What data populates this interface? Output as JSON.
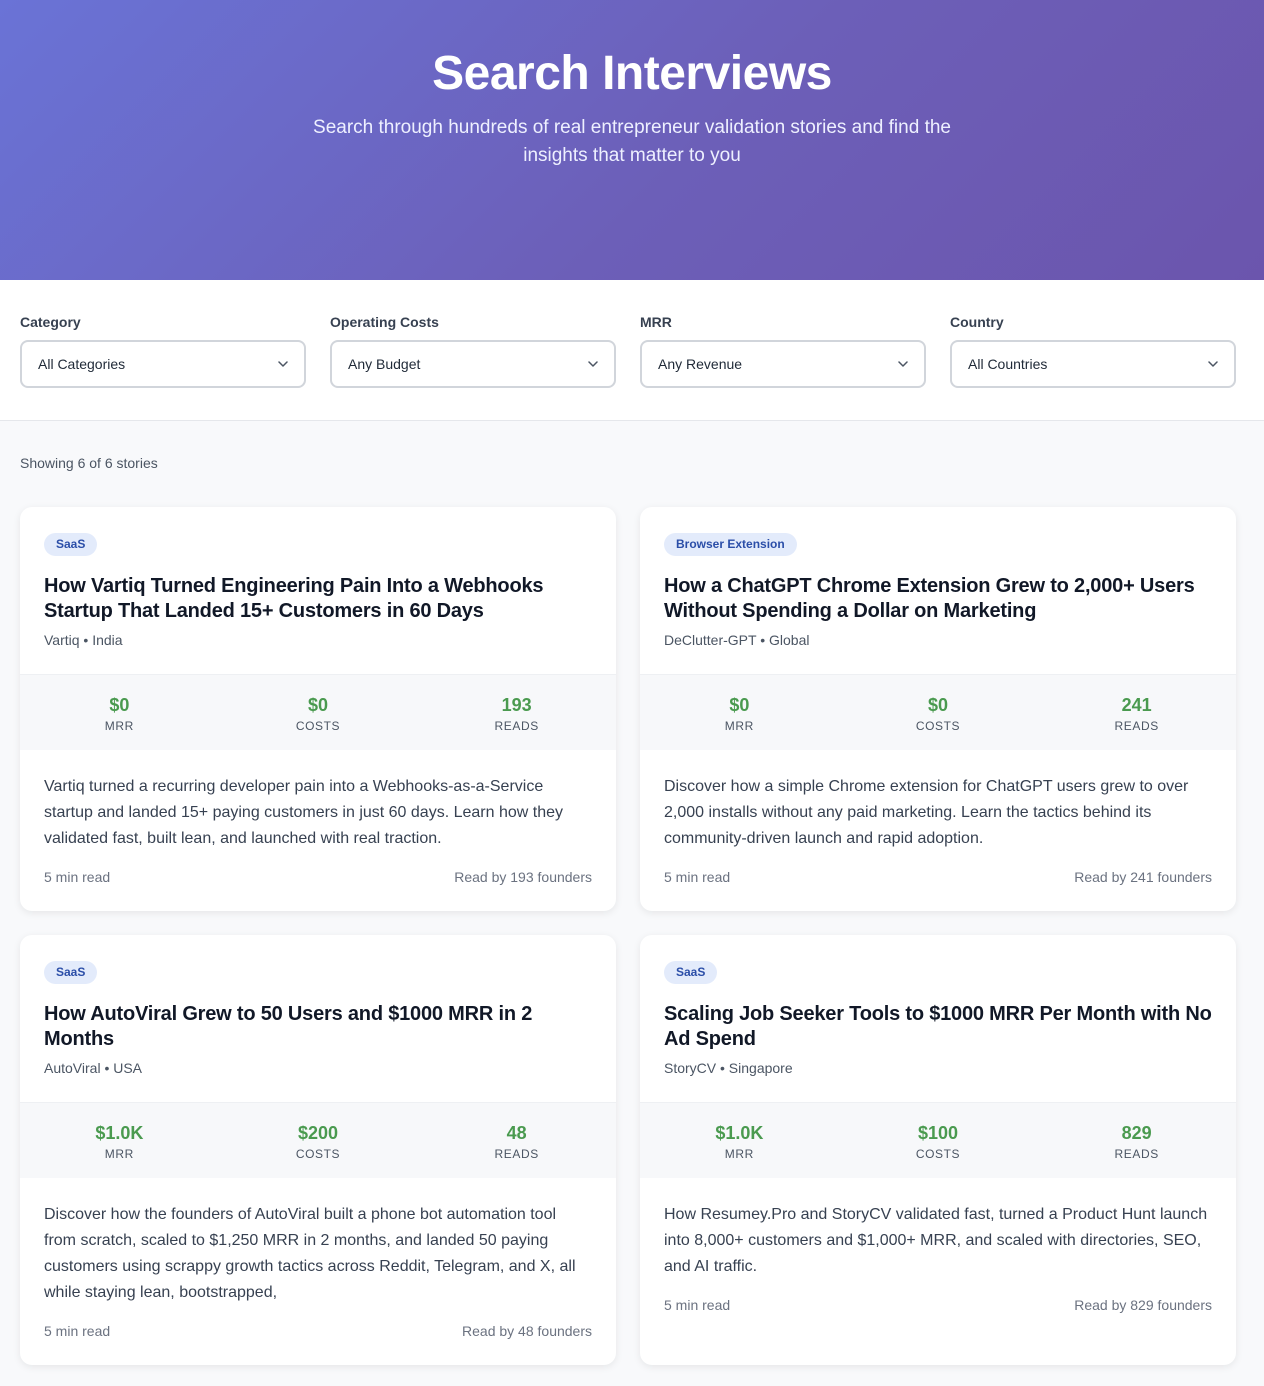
{
  "hero": {
    "title": "Search Interviews",
    "subtitle": "Search through hundreds of real entrepreneur validation stories and find the insights that matter to you"
  },
  "filters": [
    {
      "label": "Category",
      "value": "All Categories"
    },
    {
      "label": "Operating Costs",
      "value": "Any Budget"
    },
    {
      "label": "MRR",
      "value": "Any Revenue"
    },
    {
      "label": "Country",
      "value": "All Countries"
    }
  ],
  "results": {
    "count_text": "Showing 6 of 6 stories"
  },
  "stat_labels": {
    "mrr": "MRR",
    "costs": "COSTS",
    "reads": "READS"
  },
  "cards": [
    {
      "tag": "SaaS",
      "title": "How Vartiq Turned Engineering Pain Into a Webhooks Startup That Landed 15+ Customers in 60 Days",
      "meta": "Vartiq • India",
      "mrr": "$0",
      "costs": "$0",
      "reads": "193",
      "description": "Vartiq turned a recurring developer pain into a Webhooks-as-a-Service startup and landed 15+ paying customers in just 60 days. Learn how they validated fast, built lean, and launched with real traction.",
      "read_time": "5 min read",
      "read_by": "Read by 193 founders"
    },
    {
      "tag": "Browser Extension",
      "title": "How a ChatGPT Chrome Extension Grew to 2,000+ Users Without Spending a Dollar on Marketing",
      "meta": "DeClutter-GPT • Global",
      "mrr": "$0",
      "costs": "$0",
      "reads": "241",
      "description": "Discover how a simple Chrome extension for ChatGPT users grew to over 2,000 installs without any paid marketing. Learn the tactics behind its community-driven launch and rapid adoption.",
      "read_time": "5 min read",
      "read_by": "Read by 241 founders"
    },
    {
      "tag": "SaaS",
      "title": "How AutoViral Grew to 50 Users and $1000 MRR in 2 Months",
      "meta": "AutoViral • USA",
      "mrr": "$1.0K",
      "costs": "$200",
      "reads": "48",
      "description": "Discover how the founders of AutoViral built a phone bot automation tool from scratch, scaled to $1,250 MRR in 2 months, and landed 50 paying customers using scrappy growth tactics across Reddit, Telegram, and X, all while staying lean, bootstrapped,",
      "read_time": "5 min read",
      "read_by": "Read by 48 founders"
    },
    {
      "tag": "SaaS",
      "title": "Scaling Job Seeker Tools to $1000 MRR Per Month with No Ad Spend",
      "meta": "StoryCV • Singapore",
      "mrr": "$1.0K",
      "costs": "$100",
      "reads": "829",
      "description": "How Resumey.Pro and StoryCV validated fast, turned a Product Hunt launch into 8,000+ customers and $1,000+ MRR, and scaled with directories, SEO, and AI traffic.",
      "read_time": "5 min read",
      "read_by": "Read by 829 founders"
    }
  ]
}
